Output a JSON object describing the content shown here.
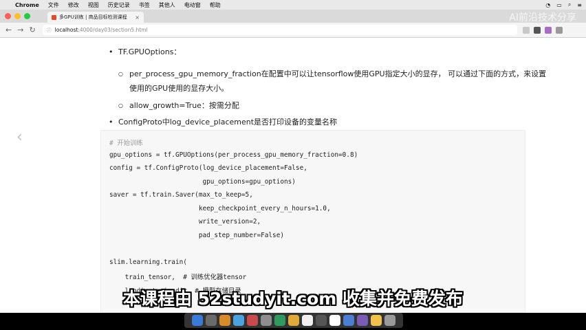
{
  "menubar": {
    "items": [
      "Chrome",
      "文件",
      "修改",
      "视图",
      "历史记录",
      "书签",
      "其他人",
      "电动窗",
      "帮助"
    ]
  },
  "browser": {
    "tab_title": "多GPU训练 | 商品目标检测课程",
    "url_host": "localhost",
    "url_path": ":4000/day03/section5.html",
    "watermark": "AI前沿技术分享"
  },
  "content": {
    "bullet1": "TF.GPUOptions：",
    "sub1": "per_process_gpu_memory_fraction在配置中可以让tensorflow使用GPU指定大小的显存， 可以通过下面的方式，来设置使用的GPU使用的显存大小。",
    "sub2": "allow_growth=True：按需分配",
    "bullet2": "ConfigProto中log_device_placement是否打印设备的变量名称",
    "code_lines": [
      "# 开始训练",
      "gpu_options = tf.GPUOptions(per_process_gpu_memory_fraction=0.8)",
      "config = tf.ConfigProto(log_device_placement=False,",
      "                        gpu_options=gpu_options)",
      "saver = tf.train.Saver(max_to_keep=5,",
      "                       keep_checkpoint_every_n_hours=1.0,",
      "                       write_version=2,",
      "                       pad_step_number=False)",
      "",
      "slim.learning.train(",
      "    train_tensor,  # 训练优化器tensor",
      "    logdir=train_dir, # 模型存储目录"
    ]
  },
  "subtitle": "本课程由 52studyit.com 收集并免费发布",
  "colors": {
    "accent": "#e34c26",
    "dock_icons": [
      "#3b7bd8",
      "#6a6a6a",
      "#d98b2b",
      "#4aa3df",
      "#c94a4a",
      "#8e8e8e",
      "#2f9a5e",
      "#e0a93a",
      "#f0f0f0",
      "#555555",
      "#ffffff",
      "#4c7fd1",
      "#7b5bb5",
      "#f2c14e",
      "#9a9a9a"
    ]
  }
}
